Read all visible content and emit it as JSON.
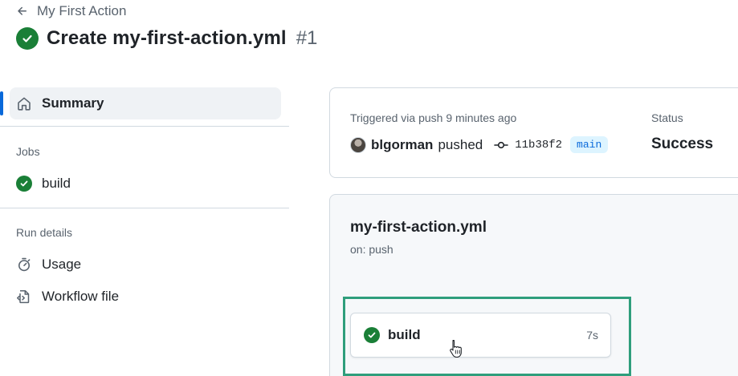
{
  "header": {
    "back_label": "My First Action",
    "title": "Create my-first-action.yml",
    "run_number": "#1"
  },
  "sidebar": {
    "summary_label": "Summary",
    "jobs_heading": "Jobs",
    "jobs": [
      {
        "label": "build"
      }
    ],
    "run_details_heading": "Run details",
    "usage_label": "Usage",
    "workflow_file_label": "Workflow file"
  },
  "summary": {
    "triggered_text": "Triggered via push 9 minutes ago",
    "actor": "blgorman",
    "action": "pushed",
    "commit_sha": "11b38f2",
    "branch": "main",
    "status_label": "Status",
    "status_value": "Success"
  },
  "workflow": {
    "file_name": "my-first-action.yml",
    "trigger": "on: push",
    "job": {
      "name": "build",
      "duration": "7s"
    }
  },
  "colors": {
    "success_green": "#1a7f37",
    "accent_blue": "#0969da",
    "highlight_teal": "#2f9e7c"
  }
}
